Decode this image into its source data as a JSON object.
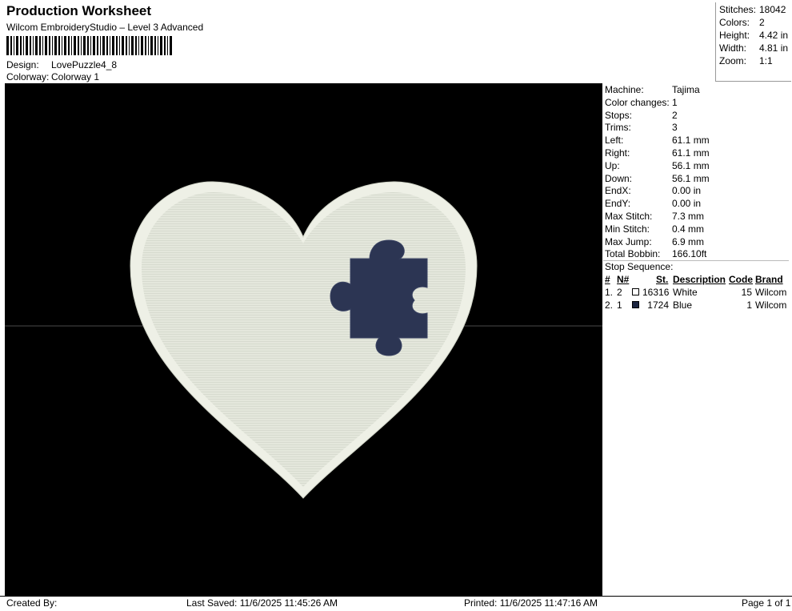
{
  "header": {
    "title": "Production Worksheet",
    "subtitle": "Wilcom EmbroideryStudio – Level 3 Advanced",
    "design_label": "Design:",
    "design_value": "LovePuzzle4_8",
    "colorway_label": "Colorway:",
    "colorway_value": "Colorway 1"
  },
  "stats": [
    {
      "label": "Stitches:",
      "value": "18042"
    },
    {
      "label": "Colors:",
      "value": "2"
    },
    {
      "label": "Height:",
      "value": "4.42 in"
    },
    {
      "label": "Width:",
      "value": "4.81 in"
    },
    {
      "label": "Zoom:",
      "value": "1:1"
    }
  ],
  "details": [
    {
      "label": "Machine:",
      "value": "Tajima"
    },
    {
      "label": "Color changes:",
      "value": "1"
    },
    {
      "label": "Stops:",
      "value": "2"
    },
    {
      "label": "Trims:",
      "value": "3"
    },
    {
      "label": "Left:",
      "value": "61.1 mm"
    },
    {
      "label": "Right:",
      "value": "61.1 mm"
    },
    {
      "label": "Up:",
      "value": "56.1 mm"
    },
    {
      "label": "Down:",
      "value": "56.1 mm"
    },
    {
      "label": "EndX:",
      "value": "0.00 in"
    },
    {
      "label": "EndY:",
      "value": "0.00 in"
    },
    {
      "label": "Max Stitch:",
      "value": "7.3 mm"
    },
    {
      "label": "Min Stitch:",
      "value": "0.4 mm"
    },
    {
      "label": "Max Jump:",
      "value": "6.9 mm"
    },
    {
      "label": "Total Bobbin:",
      "value": "166.10ft"
    }
  ],
  "stop_sequence": {
    "title": "Stop Sequence:",
    "headers": {
      "num": "#",
      "needle": "N#",
      "stitches": "St.",
      "description": "Description",
      "code": "Code",
      "brand": "Brand"
    },
    "rows": [
      {
        "num": "1.",
        "needle": "2",
        "color": "#ffffff",
        "stitches": "16316",
        "description": "White",
        "code": "15",
        "brand": "Wilcom"
      },
      {
        "num": "2.",
        "needle": "1",
        "color": "#1c2540",
        "stitches": "1724",
        "description": "Blue",
        "code": "1",
        "brand": "Wilcom"
      }
    ]
  },
  "colors": {
    "thread_white": "#e6e9df",
    "thread_white_border": "#eef0e6",
    "thread_blue": "#2c3553",
    "canvas": "#000000"
  },
  "footer": {
    "created_by": "Created By:",
    "last_saved": "Last Saved: 11/6/2025 11:45:26 AM",
    "printed": "Printed: 11/6/2025 11:47:16 AM",
    "page": "Page 1 of 1"
  }
}
